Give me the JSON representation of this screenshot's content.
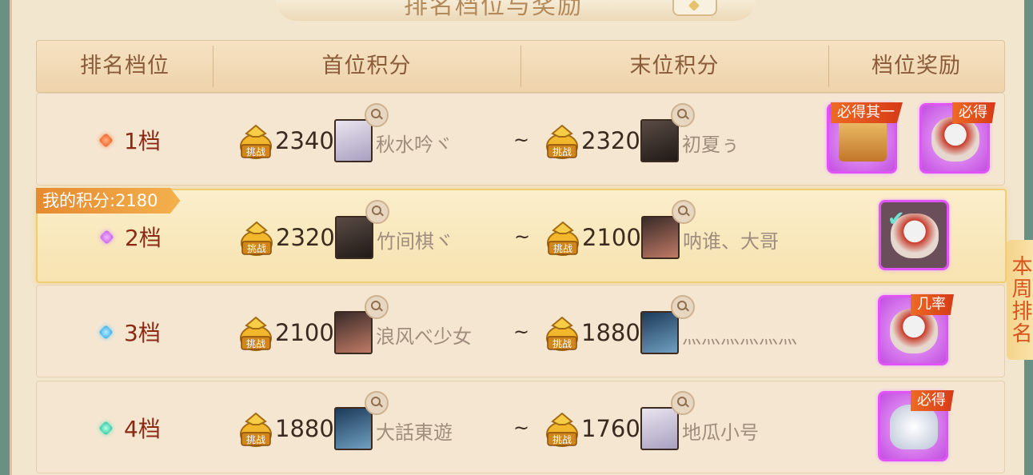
{
  "title": "排名档位与奖励",
  "headers": [
    "排名档位",
    "首位积分",
    "末位积分",
    "档位奖励"
  ],
  "my_score_label": "我的积分:2180",
  "side_tab": "本周排名",
  "rows": [
    {
      "tier": "1档",
      "gem": "orange",
      "first_score": "2340",
      "first_name": "秋水吟ヾ",
      "last_score": "2320",
      "last_name": "初夏ぅ",
      "rewards": [
        {
          "tag": "必得其一",
          "icon": "treasure-chest-icon"
        },
        {
          "tag": "必得",
          "icon": "silver-bag-icon"
        }
      ]
    },
    {
      "tier": "2档",
      "gem": "purple",
      "first_score": "2320",
      "first_name": "竹间棋ヾ",
      "last_score": "2100",
      "last_name": "呐谁、大哥",
      "rewards": [
        {
          "tag": "",
          "icon": "silver-bag-icon",
          "claimed": true
        }
      ]
    },
    {
      "tier": "3档",
      "gem": "blue",
      "first_score": "2100",
      "first_name": "浪风べ少女",
      "last_score": "1880",
      "last_name": "灬灬灬灬灬灬",
      "rewards": [
        {
          "tag": "几率",
          "icon": "silver-bag-icon"
        }
      ]
    },
    {
      "tier": "4档",
      "gem": "teal",
      "first_score": "1880",
      "first_name": "大話東遊",
      "last_score": "1760",
      "last_name": "地瓜小号",
      "rewards": [
        {
          "tag": "必得",
          "icon": "silver-pile-icon"
        }
      ]
    }
  ],
  "tilde": "~",
  "colors": {
    "accent": "#e054f7",
    "tag": "#e1501d",
    "highlight": "#f0cc72"
  }
}
